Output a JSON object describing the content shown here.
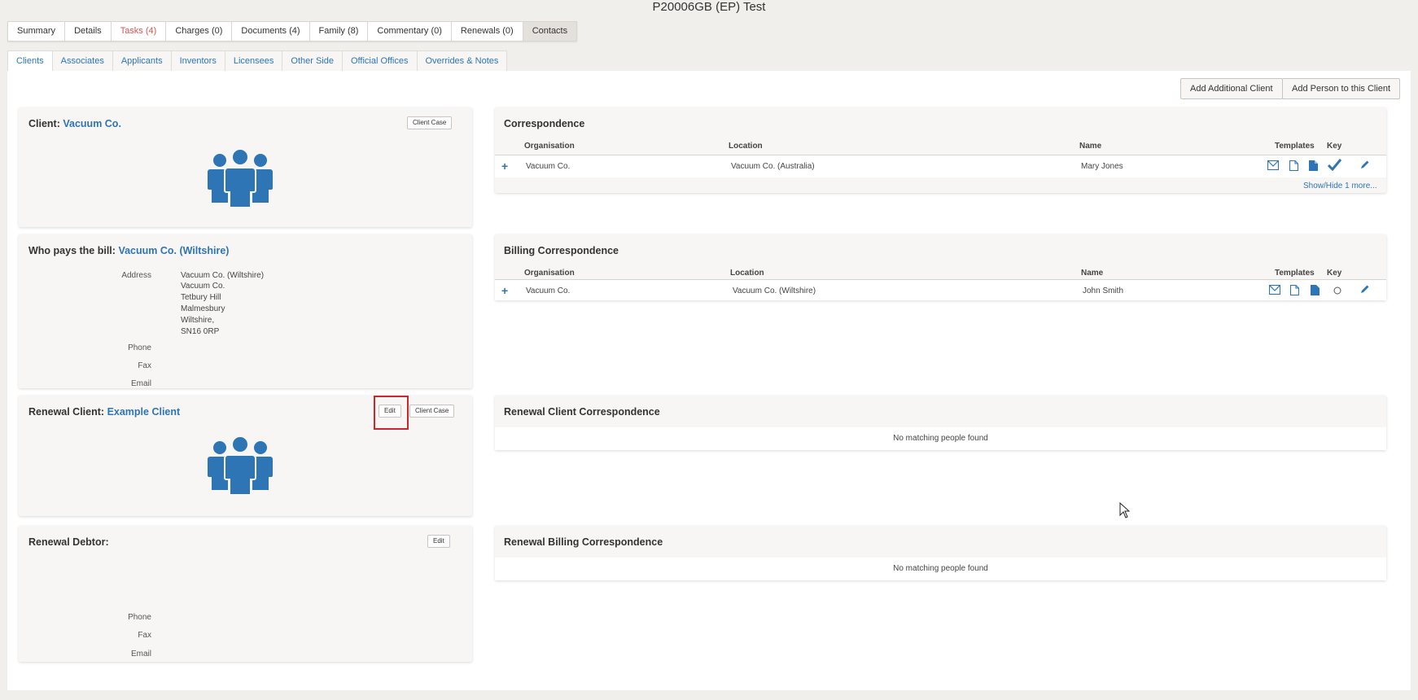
{
  "page_title": "P20006GB (EP) Test",
  "top_tabs": [
    {
      "label": "Summary"
    },
    {
      "label": "Details"
    },
    {
      "label": "Tasks (4)"
    },
    {
      "label": "Charges (0)"
    },
    {
      "label": "Documents (4)"
    },
    {
      "label": "Family (8)"
    },
    {
      "label": "Commentary (0)"
    },
    {
      "label": "Renewals (0)"
    },
    {
      "label": "Contacts"
    }
  ],
  "sub_tabs": [
    {
      "label": "Clients"
    },
    {
      "label": "Associates"
    },
    {
      "label": "Applicants"
    },
    {
      "label": "Inventors"
    },
    {
      "label": "Licensees"
    },
    {
      "label": "Other Side"
    },
    {
      "label": "Official Offices"
    },
    {
      "label": "Overrides & Notes"
    }
  ],
  "actions": {
    "add_client": "Add Additional Client",
    "add_person": "Add Person to this Client"
  },
  "client": {
    "label": "Client:",
    "name": "Vacuum Co.",
    "case_btn": "Client Case"
  },
  "bill": {
    "label": "Who pays the bill:",
    "name": "Vacuum Co. (Wiltshire)",
    "address_label": "Address",
    "address_lines": [
      "Vacuum Co. (Wiltshire)",
      "Vacuum Co.",
      "Tetbury Hill",
      "Malmesbury",
      "Wiltshire,",
      "SN16 0RP"
    ],
    "phone_label": "Phone",
    "fax_label": "Fax",
    "email_label": "Email"
  },
  "renewal_client": {
    "label": "Renewal Client:",
    "name": "Example Client",
    "edit_btn": "Edit",
    "case_btn": "Client Case"
  },
  "renewal_debtor": {
    "label": "Renewal Debtor:",
    "edit_btn": "Edit",
    "phone_label": "Phone",
    "fax_label": "Fax",
    "email_label": "Email"
  },
  "columns": {
    "organisation": "Organisation",
    "location": "Location",
    "name": "Name",
    "templates": "Templates",
    "key": "Key"
  },
  "correspondence": {
    "title": "Correspondence",
    "rows": [
      {
        "organisation": "Vacuum Co.",
        "location": "Vacuum Co. (Australia)",
        "name": "Mary Jones"
      }
    ],
    "show_more": "Show/Hide 1 more..."
  },
  "billing_correspondence": {
    "title": "Billing Correspondence",
    "rows": [
      {
        "organisation": "Vacuum Co.",
        "location": "Vacuum Co. (Wiltshire)",
        "name": "John Smith"
      }
    ]
  },
  "renewal_client_correspondence": {
    "title": "Renewal Client Correspondence",
    "empty": "No matching people found"
  },
  "renewal_billing_correspondence": {
    "title": "Renewal Billing Correspondence",
    "empty": "No matching people found"
  },
  "colors": {
    "accent": "#2e75b6",
    "alert": "#d9534f",
    "highlight": "#d0262b"
  }
}
